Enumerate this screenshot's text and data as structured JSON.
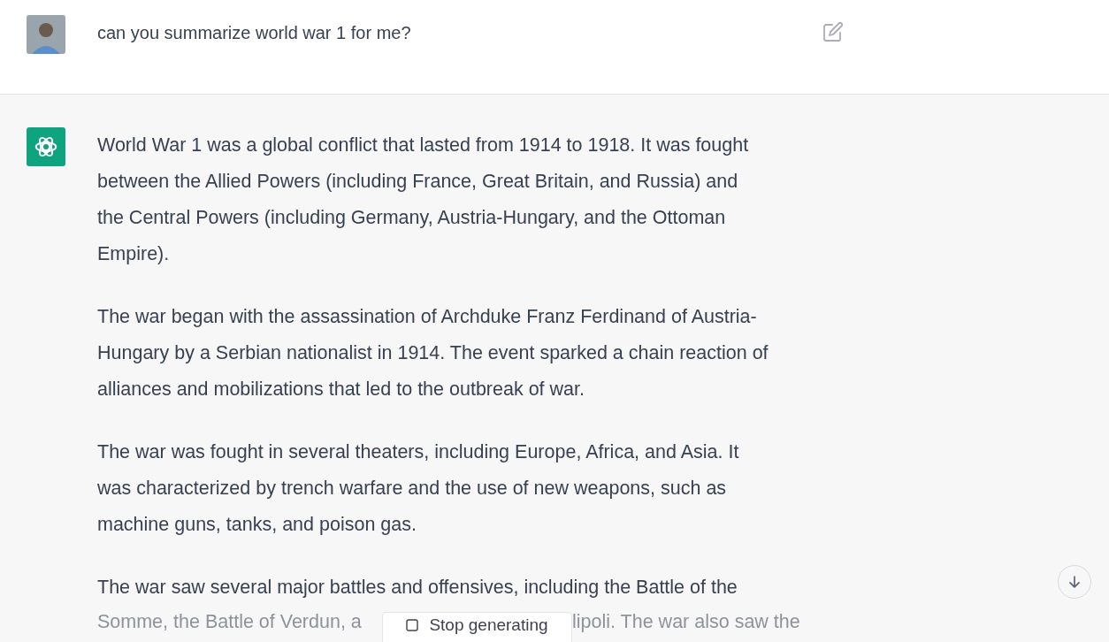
{
  "user_message": {
    "text": "can you summarize world war 1 for me?"
  },
  "assistant_message": {
    "paragraphs": [
      "World War 1 was a global conflict that lasted from 1914 to 1918. It was fought between the Allied Powers (including France, Great Britain, and Russia) and the Central Powers (including Germany, Austria-Hungary, and the Ottoman Empire).",
      "The war began with the assassination of Archduke Franz Ferdinand of Austria-Hungary by a Serbian nationalist in 1914. The event sparked a chain reaction of alliances and mobilizations that led to the outbreak of war.",
      "The war was fought in several theaters, including Europe, Africa, and Asia. It was characterized by trench warfare and the use of new weapons, such as machine guns, tanks, and poison gas.",
      "The war saw several major battles and offensives, including the Battle of the"
    ],
    "faded_line": [
      "Somme, the Battle of Verdun, a",
      "lipoli. The war also saw the"
    ]
  },
  "stop_button": {
    "label": "Stop generating"
  }
}
